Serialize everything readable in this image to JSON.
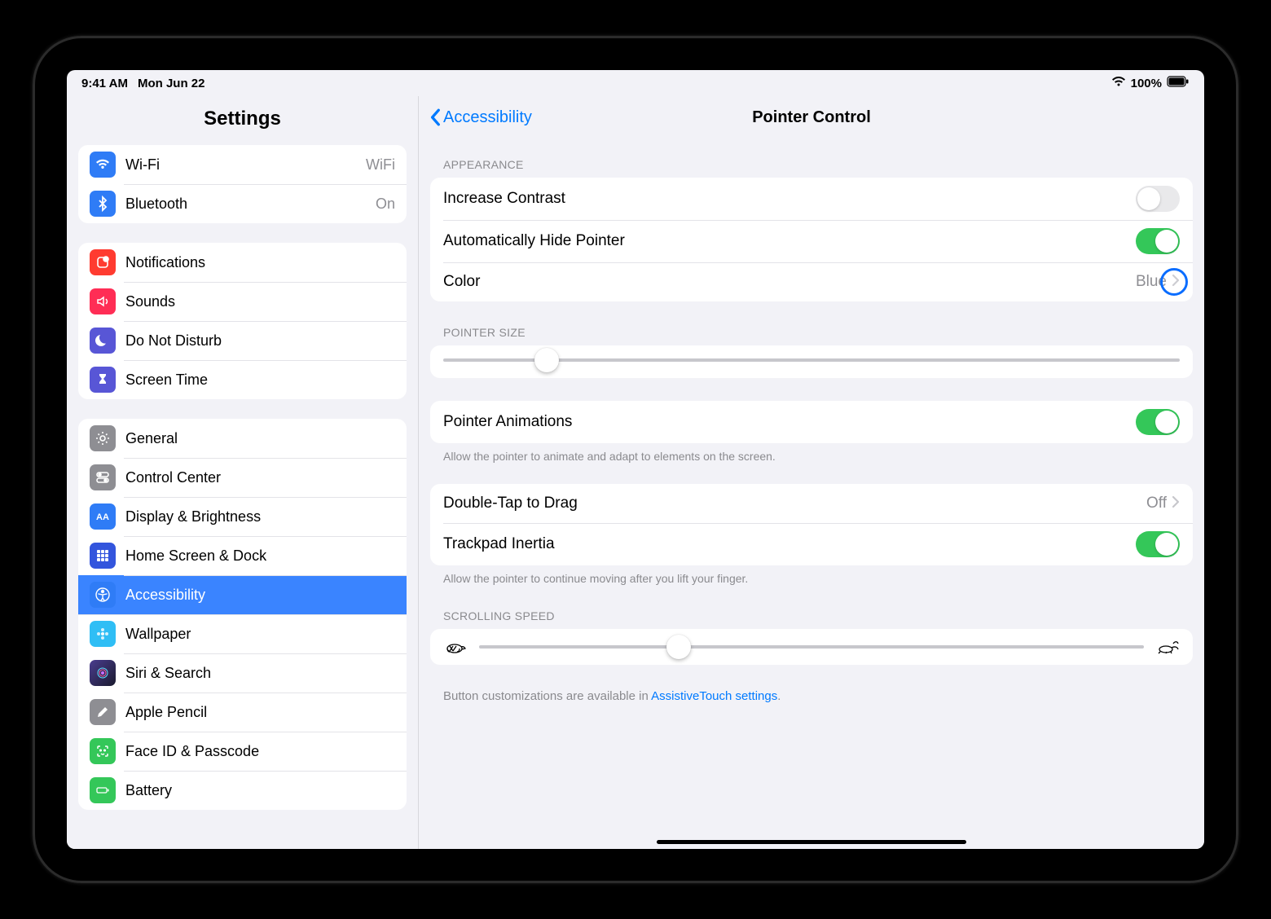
{
  "status": {
    "time": "9:41 AM",
    "date": "Mon Jun 22",
    "battery": "100%"
  },
  "sidebar": {
    "title": "Settings",
    "g1": [
      {
        "label": "Wi-Fi",
        "val": "WiFi",
        "icon": "wifi",
        "bg": "#2f7cf6"
      },
      {
        "label": "Bluetooth",
        "val": "On",
        "icon": "bluetooth",
        "bg": "#2f7cf6"
      }
    ],
    "g2": [
      {
        "label": "Notifications",
        "icon": "bell",
        "bg": "#ff3b30"
      },
      {
        "label": "Sounds",
        "icon": "sound",
        "bg": "#ff2d55"
      },
      {
        "label": "Do Not Disturb",
        "icon": "moon",
        "bg": "#5856d6"
      },
      {
        "label": "Screen Time",
        "icon": "hourglass",
        "bg": "#5856d6"
      }
    ],
    "g3": [
      {
        "label": "General",
        "icon": "gear",
        "bg": "#8e8e93"
      },
      {
        "label": "Control Center",
        "icon": "switches",
        "bg": "#8e8e93"
      },
      {
        "label": "Display & Brightness",
        "icon": "aa",
        "bg": "#2f7cf6"
      },
      {
        "label": "Home Screen & Dock",
        "icon": "grid",
        "bg": "#3355dd"
      },
      {
        "label": "Accessibility",
        "icon": "person",
        "bg": "#2f7cf6",
        "selected": true
      },
      {
        "label": "Wallpaper",
        "icon": "flower",
        "bg": "#2fbef5"
      },
      {
        "label": "Siri & Search",
        "icon": "siri",
        "bg": "#222"
      },
      {
        "label": "Apple Pencil",
        "icon": "pencil",
        "bg": "#8e8e93"
      },
      {
        "label": "Face ID & Passcode",
        "icon": "face",
        "bg": "#34c759"
      },
      {
        "label": "Battery",
        "icon": "battery",
        "bg": "#34c759"
      }
    ]
  },
  "detail": {
    "back": "Accessibility",
    "title": "Pointer Control",
    "appearance_header": "APPEARANCE",
    "increase_contrast": "Increase Contrast",
    "auto_hide": "Automatically Hide Pointer",
    "color_label": "Color",
    "color_value": "Blue",
    "pointer_size_header": "POINTER SIZE",
    "pointer_size_pct": 14,
    "animations_label": "Pointer Animations",
    "animations_note": "Allow the pointer to animate and adapt to elements on the screen.",
    "double_tap_label": "Double-Tap to Drag",
    "double_tap_value": "Off",
    "inertia_label": "Trackpad Inertia",
    "inertia_note": "Allow the pointer to continue moving after you lift your finger.",
    "scroll_header": "SCROLLING SPEED",
    "scroll_pct": 30,
    "assistive_prefix": "Button customizations are available in ",
    "assistive_link": "AssistiveTouch settings"
  }
}
